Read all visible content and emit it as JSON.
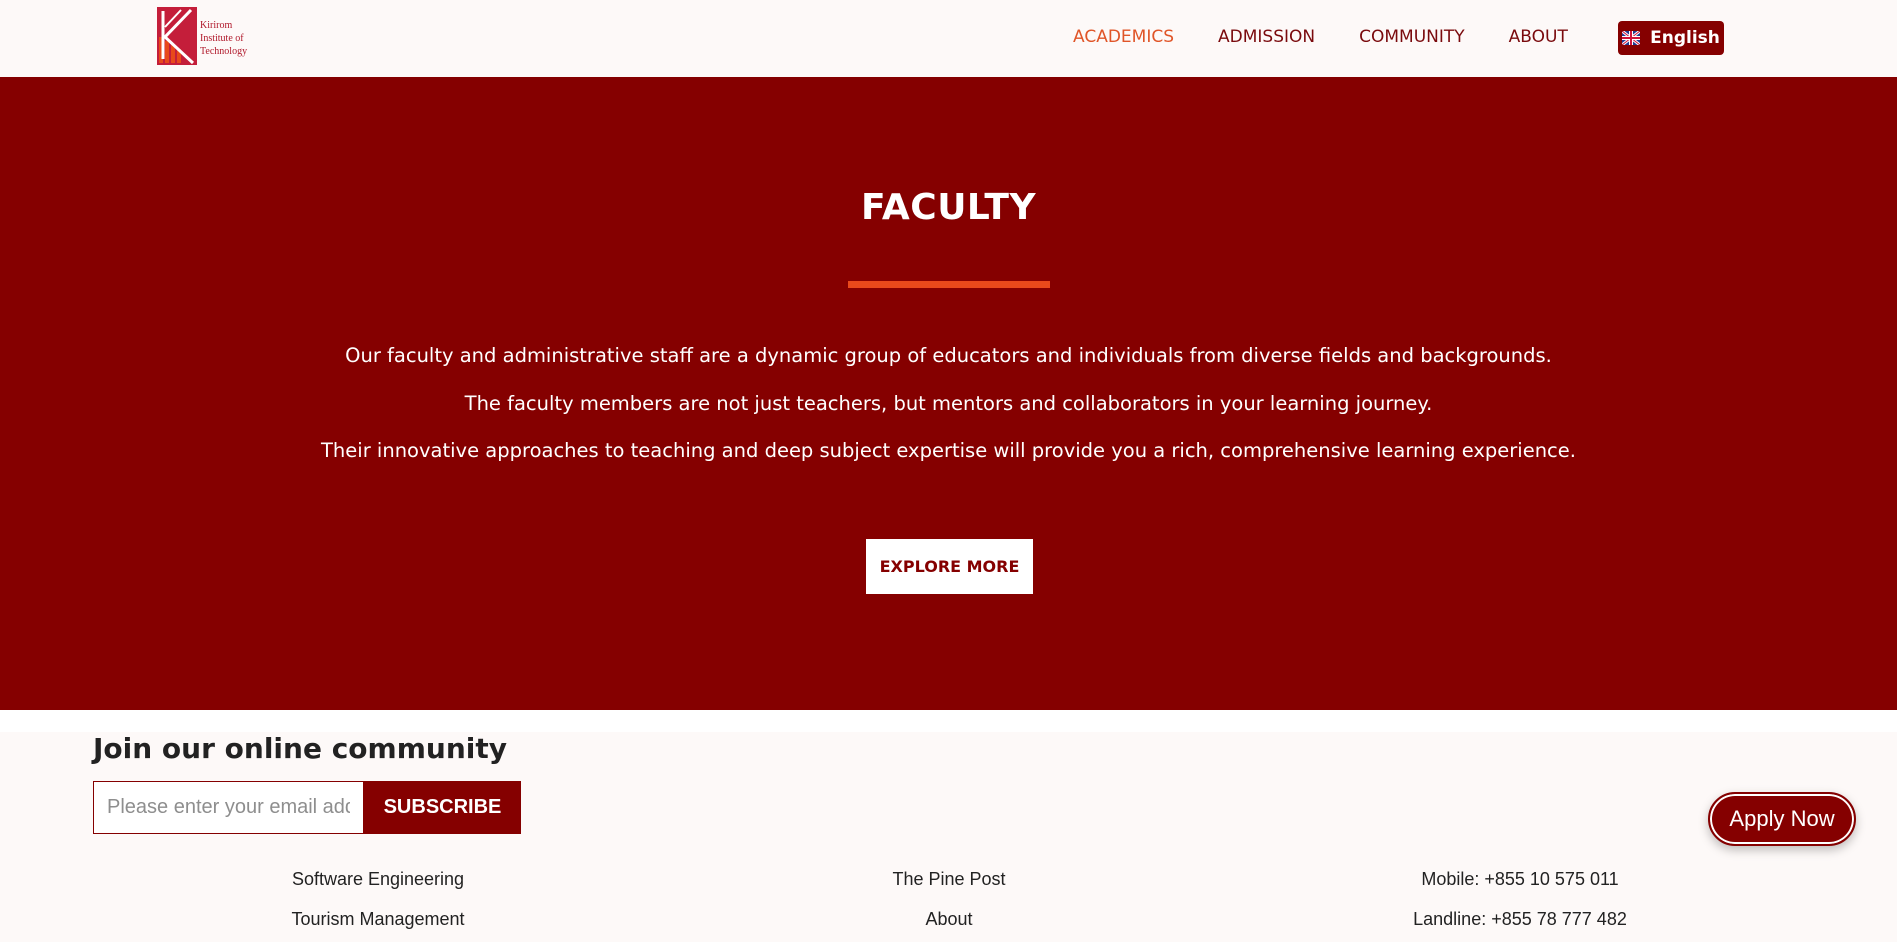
{
  "header": {
    "logo": {
      "lines": [
        "Kirirom",
        "Institute of",
        "Technology"
      ]
    },
    "nav": [
      {
        "label": "ACADEMICS",
        "active": true
      },
      {
        "label": "ADMISSION",
        "active": false
      },
      {
        "label": "COMMUNITY",
        "active": false
      },
      {
        "label": "ABOUT",
        "active": false
      }
    ],
    "language": {
      "label": "English",
      "icon": "uk-flag-icon"
    }
  },
  "hero": {
    "title": "FACULTY",
    "lines": [
      "Our faculty and administrative staff are a dynamic group of educators and individuals from diverse fields and backgrounds.",
      "The faculty members are not just teachers, but mentors and collaborators in your learning journey.",
      "Their innovative approaches to teaching and deep subject expertise will provide you a rich, comprehensive learning experience."
    ],
    "button_label": "EXPLORE MORE"
  },
  "footer": {
    "community_title": "Join our online community",
    "email_placeholder": "Please enter your email address",
    "subscribe_label": "SUBSCRIBE",
    "apply_label": "Apply Now",
    "columns": [
      [
        "Software Engineering",
        "Tourism Management"
      ],
      [
        "The Pine Post",
        "About"
      ],
      [
        "Mobile: +855 10 575 011",
        "Landline: +855 78 777 482"
      ]
    ]
  },
  "colors": {
    "brand": "#850000",
    "accent": "#e05528",
    "background": "#fdf9f8"
  }
}
